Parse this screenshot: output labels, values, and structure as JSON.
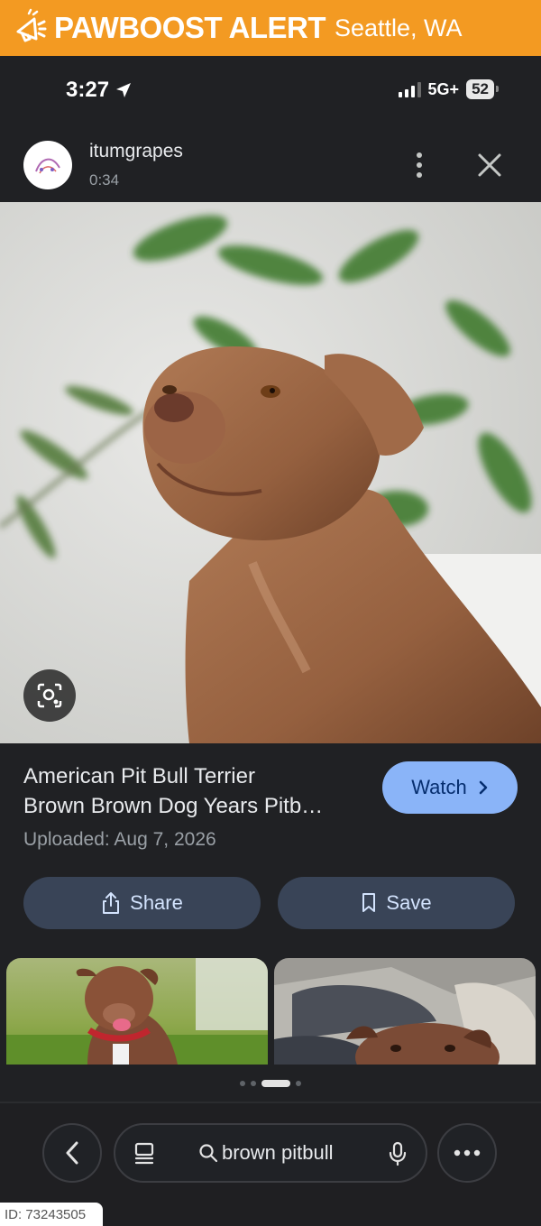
{
  "banner": {
    "brand": "PAWBOOST ALERT",
    "location": "Seattle, WA",
    "background": "#f39a22"
  },
  "status_bar": {
    "time": "3:27",
    "network": "5G+",
    "battery": "52"
  },
  "header": {
    "username": "itumgrapes",
    "duration": "0:34",
    "icons": [
      "more-vert-icon",
      "close-icon"
    ]
  },
  "result": {
    "title_line1": "American Pit Bull Terrier",
    "title_line2": "Brown Brown Dog Years Pitb…",
    "uploaded": "Uploaded: Aug 7, 2026",
    "watch_label": "Watch",
    "share_label": "Share",
    "save_label": "Save"
  },
  "carousel": {
    "active_index": 2,
    "count": 4
  },
  "bottom_bar": {
    "query": "brown pitbull",
    "icons": [
      "back-icon",
      "tabs-icon",
      "search-icon",
      "mic-icon",
      "more-horiz-icon"
    ]
  },
  "footer": {
    "id_tag": "ID: 73243505"
  },
  "colors": {
    "accent": "#8ab4f8",
    "button_bg": "#394457",
    "page_bg": "#202124"
  }
}
